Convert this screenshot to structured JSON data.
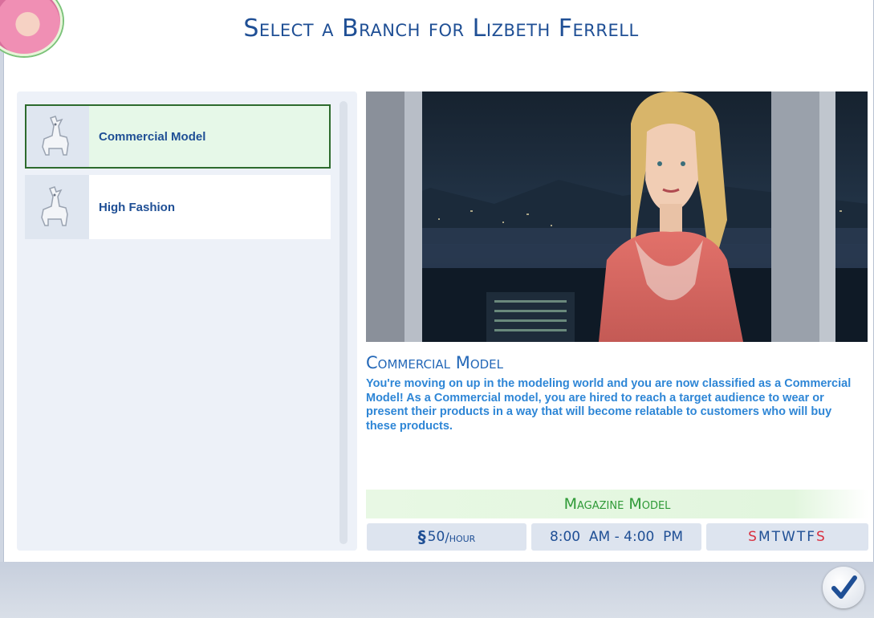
{
  "dialog": {
    "title": "Select a Branch for Lizbeth Ferrell"
  },
  "branches": [
    {
      "label": "Commercial Model",
      "icon": "llama-icon",
      "selected": true
    },
    {
      "label": "High Fashion",
      "icon": "llama-icon",
      "selected": false
    }
  ],
  "detail": {
    "title": "Commercial Model",
    "description": "You're moving on up in the modeling world and you are now classified as a Commercial Model! As a Commercial model, you are hired to reach a target audience to wear or present their products in a way that will become relatable to customers who will buy these products.",
    "level_name": "Magazine Model",
    "pay_symbol": "§",
    "pay_value": "50",
    "pay_unit": "/hour",
    "hours": "8:00  AM - 4:00  PM",
    "days": [
      "S",
      "M",
      "T",
      "W",
      "T",
      "F",
      "S"
    ]
  },
  "colors": {
    "title": "#1f4f95",
    "work_day": "#1f4f95",
    "off_day": "#d93040",
    "level_name": "#2f9a37",
    "selected_border": "#2d6b2d"
  },
  "footer": {
    "confirm_icon": "checkmark-icon"
  }
}
